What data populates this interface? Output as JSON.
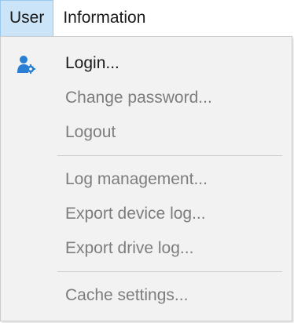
{
  "menubar": {
    "items": [
      {
        "label": "User"
      },
      {
        "label": "Information"
      }
    ]
  },
  "user_menu": {
    "login": "Login...",
    "change_password": "Change password...",
    "logout": "Logout",
    "log_management": "Log management...",
    "export_device_log": "Export device log...",
    "export_drive_log": "Export drive log...",
    "cache_settings": "Cache settings..."
  },
  "colors": {
    "active_menu_bg": "#cce4f7",
    "dropdown_bg": "#f2f2f2",
    "disabled_text": "#7d7d7d",
    "icon_blue": "#2a7fd4"
  },
  "icons": {
    "login": "user-gear-icon"
  }
}
